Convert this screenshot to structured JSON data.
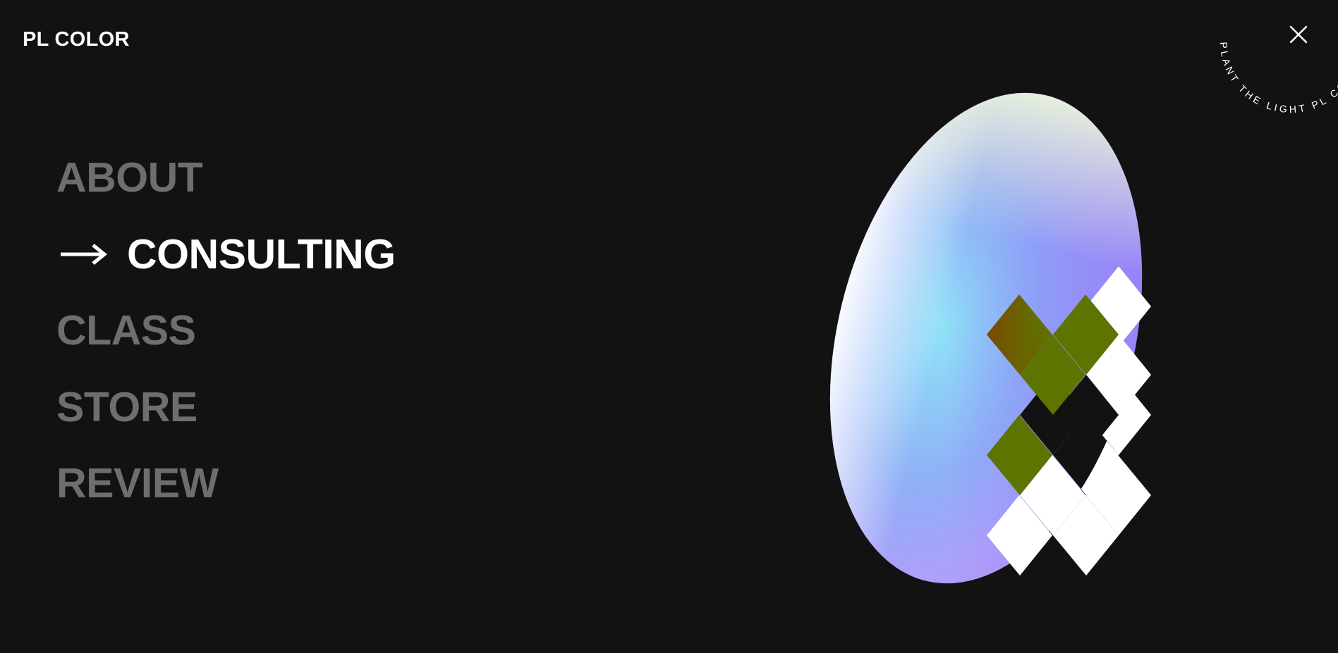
{
  "brand": {
    "name": "PL COLOR"
  },
  "header": {
    "close_icon": "close-icon"
  },
  "menu": {
    "items": [
      {
        "label": "ABOUT",
        "active": false
      },
      {
        "label": "CONSULTING",
        "active": true,
        "indicator_icon": "arrow-right-icon"
      },
      {
        "label": "CLASS",
        "active": false
      },
      {
        "label": "STORE",
        "active": false
      },
      {
        "label": "REVIEW",
        "active": false
      }
    ]
  },
  "badge": {
    "circular_text": "PLANT THE LIGHT PL COLOR "
  },
  "colors": {
    "background": "#121212",
    "active_text": "#ffffff",
    "inactive_text": "#6e6e6e",
    "gradient": [
      "#f7f9ff",
      "#8fe2f7",
      "#8c8cf7",
      "#c892fb",
      "#e3f7d6"
    ],
    "diamond_accent_brown": "#7a4a00",
    "diamond_accent_olive": "#5e7400"
  }
}
